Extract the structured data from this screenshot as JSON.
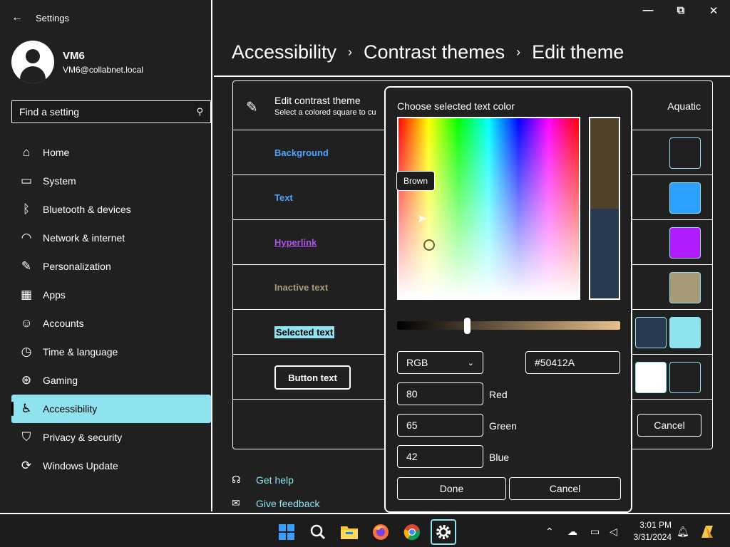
{
  "window": {
    "title": "Settings",
    "controls": {
      "minimize": "—",
      "restore": "⧉",
      "close": "✕"
    }
  },
  "profile": {
    "name": "VM6",
    "email": "VM6@collabnet.local"
  },
  "search": {
    "placeholder": "Find a setting"
  },
  "nav": [
    {
      "label": "Home",
      "icon": "home-icon",
      "glyph": "⌂"
    },
    {
      "label": "System",
      "icon": "system-icon",
      "glyph": "▭"
    },
    {
      "label": "Bluetooth & devices",
      "icon": "bluetooth-icon",
      "glyph": "ᛒ"
    },
    {
      "label": "Network & internet",
      "icon": "network-icon",
      "glyph": "◠"
    },
    {
      "label": "Personalization",
      "icon": "brush-icon",
      "glyph": "✎"
    },
    {
      "label": "Apps",
      "icon": "apps-icon",
      "glyph": "▦"
    },
    {
      "label": "Accounts",
      "icon": "accounts-icon",
      "glyph": "☺"
    },
    {
      "label": "Time & language",
      "icon": "time-icon",
      "glyph": "◷"
    },
    {
      "label": "Gaming",
      "icon": "gaming-icon",
      "glyph": "⊛"
    },
    {
      "label": "Accessibility",
      "icon": "accessibility-icon",
      "glyph": "♿",
      "active": true
    },
    {
      "label": "Privacy & security",
      "icon": "shield-icon",
      "glyph": "⛉"
    },
    {
      "label": "Windows Update",
      "icon": "update-icon",
      "glyph": "⟳"
    }
  ],
  "breadcrumb": {
    "level1": "Accessibility",
    "level2": "Contrast themes",
    "level3": "Edit theme",
    "separator": "›"
  },
  "panel": {
    "title": "Edit contrast theme",
    "subtitle": "Select a colored square to cu",
    "theme_name": "Aquatic",
    "rows": [
      {
        "label": "Background",
        "color": "#4fa3ff",
        "swatches": [
          "#202020"
        ]
      },
      {
        "label": "Text",
        "color": "#4fa3ff",
        "swatches": [
          "#2ea0ff"
        ]
      },
      {
        "label": "Hyperlink",
        "color": "#b14ff1",
        "swatches": [
          "#b11cff"
        ]
      },
      {
        "label": "Inactive text",
        "color": "#a89c78",
        "swatches": [
          "#a89c78"
        ]
      },
      {
        "label": "Selected text",
        "color": "#000000",
        "swatches": [
          "#283a50",
          "#8ee3ef"
        ]
      },
      {
        "label": "Button text",
        "color": "#ffffff",
        "swatches": [
          "#ffffff",
          "#202020"
        ]
      }
    ],
    "cancel_label": "Cancel"
  },
  "help": {
    "get_help": "Get help",
    "give_feedback": "Give feedback"
  },
  "dialog": {
    "title": "Choose selected text color",
    "tooltip": "Brown",
    "preview_new": "#50412a",
    "preview_old": "#283a50",
    "mode": "RGB",
    "hex": "#50412A",
    "red": "80",
    "green": "65",
    "blue": "42",
    "red_label": "Red",
    "green_label": "Green",
    "blue_label": "Blue",
    "done_label": "Done",
    "cancel_label": "Cancel"
  },
  "taskbar": {
    "apps": [
      {
        "name": "start-icon"
      },
      {
        "name": "search-icon"
      },
      {
        "name": "file-explorer-icon"
      },
      {
        "name": "firefox-icon"
      },
      {
        "name": "chrome-icon"
      },
      {
        "name": "settings-icon",
        "active": true
      }
    ],
    "time": "3:01 PM",
    "date": "3/31/2024"
  },
  "colors": {
    "accent": "#8ee3ef",
    "background": "#202020",
    "text": "#ffffff"
  }
}
